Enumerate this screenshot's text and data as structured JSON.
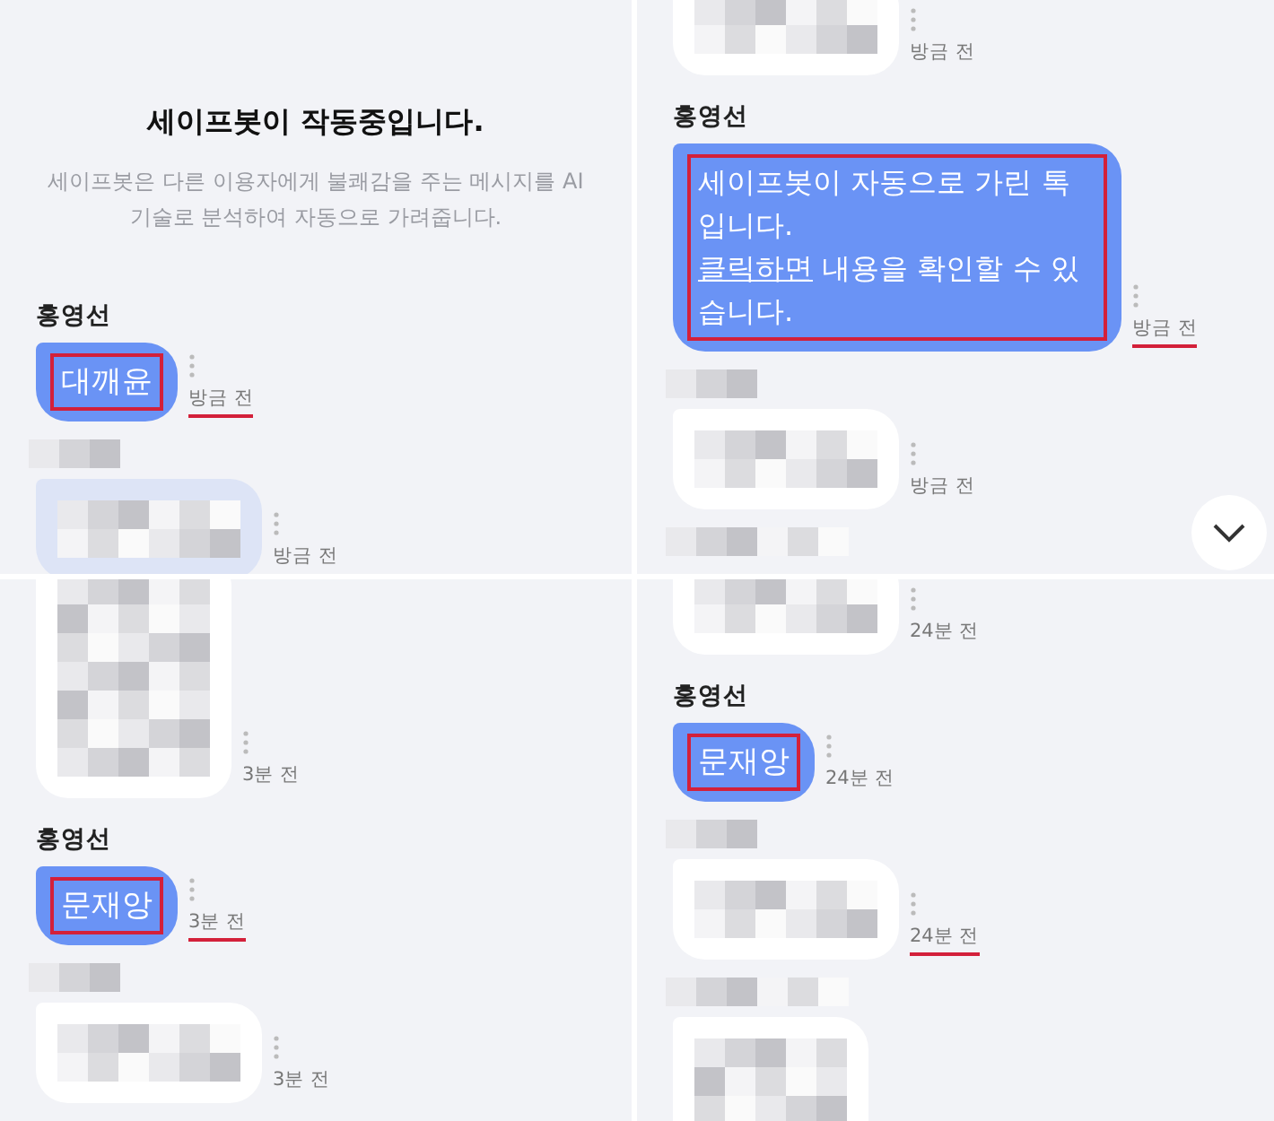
{
  "panels": [
    {
      "items": [
        {
          "kind": "notice",
          "title": "세이프봇이 작동중입니다.",
          "text": "세이프봇은 다른 이용자에게 불쾌감을 주는 메시지를 AI 기술로 분석하여 자동으로 가려줍니다."
        },
        {
          "kind": "sender",
          "name": "홍영선"
        },
        {
          "kind": "mine",
          "text": "대깨윤",
          "boxed": true,
          "time": "방금 전",
          "underlined": true
        },
        {
          "kind": "hiddenname"
        },
        {
          "kind": "hidden",
          "color": "#dde4f6",
          "time": "방금 전",
          "underlined": false
        }
      ]
    },
    {
      "scroll_button": true,
      "items": [
        {
          "kind": "hidden",
          "color": "#ffffff",
          "cut": true,
          "time": "방금 전",
          "underlined": false
        },
        {
          "kind": "sender",
          "name": "홍영선"
        },
        {
          "kind": "safebot",
          "text": "세이프봇이 자동으로 가린 톡입니다.",
          "link": "클릭하면",
          "text_after": "내용을 확인할 수 있습니다.",
          "boxed": true,
          "time": "방금 전",
          "underlined": true
        },
        {
          "kind": "hiddenname"
        },
        {
          "kind": "hidden",
          "color": "#ffffff",
          "time": "방금 전",
          "underlined": false
        },
        {
          "kind": "hiddenlongname"
        }
      ]
    },
    {
      "items": [
        {
          "kind": "hiddentall",
          "color": "#ffffff",
          "cut": true,
          "time": "3분 전",
          "underlined": false
        },
        {
          "kind": "sender",
          "name": "홍영선"
        },
        {
          "kind": "mine",
          "text": "문재앙",
          "boxed": true,
          "time": "3분 전",
          "underlined": true
        },
        {
          "kind": "hiddenname"
        },
        {
          "kind": "hidden",
          "color": "#ffffff",
          "time": "3분 전",
          "underlined": false
        }
      ]
    },
    {
      "items": [
        {
          "kind": "hidden",
          "color": "#ffffff",
          "cut": true,
          "time": "24분 전",
          "underlined": false
        },
        {
          "kind": "sender",
          "name": "홍영선"
        },
        {
          "kind": "mine",
          "text": "문재앙",
          "boxed": true,
          "time": "24분 전",
          "underlined": false
        },
        {
          "kind": "hiddenname"
        },
        {
          "kind": "hidden",
          "color": "#ffffff",
          "time": "24분 전",
          "underlined": true
        },
        {
          "kind": "hiddenlongname"
        },
        {
          "kind": "hiddentall",
          "color": "#ffffff"
        }
      ]
    }
  ]
}
